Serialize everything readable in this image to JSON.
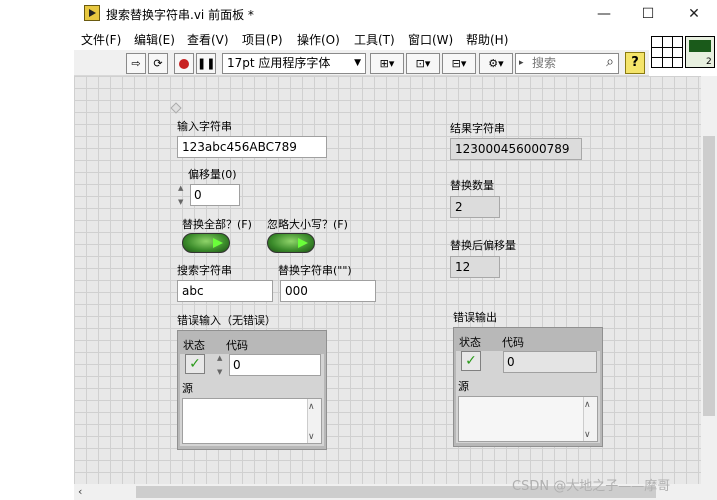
{
  "window": {
    "title": "搜索替换字符串.vi 前面板 *",
    "minimize": "—",
    "maximize": "☐",
    "close": "✕"
  },
  "menu": [
    "文件(F)",
    "编辑(E)",
    "查看(V)",
    "项目(P)",
    "操作(O)",
    "工具(T)",
    "窗口(W)",
    "帮助(H)"
  ],
  "toolbar": {
    "font": "17pt 应用程序字体",
    "search_placeholder": "搜索",
    "help": "?",
    "connector_count": "2"
  },
  "controls": {
    "input_string": {
      "label": "输入字符串",
      "value": "123abc456ABC789"
    },
    "offset": {
      "label": "偏移量(0)",
      "value": "0"
    },
    "replace_all": {
      "label": "替换全部？(F)"
    },
    "ignore_case": {
      "label": "忽略大小写？(F)"
    },
    "search_string": {
      "label": "搜索字符串",
      "value": "abc"
    },
    "replace_string": {
      "label": "替换字符串(\"\")",
      "value": "000"
    },
    "error_in": {
      "label": "错误输入（无错误）",
      "status_label": "状态",
      "code_label": "代码",
      "code_value": "0",
      "source_label": "源"
    }
  },
  "indicators": {
    "result_string": {
      "label": "结果字符串",
      "value": "123000456000789"
    },
    "replace_count": {
      "label": "替换数量",
      "value": "2"
    },
    "offset_past": {
      "label": "替换后偏移量",
      "value": "12"
    },
    "error_out": {
      "label": "错误输出",
      "status_label": "状态",
      "code_label": "代码",
      "code_value": "0",
      "source_label": "源"
    }
  },
  "watermark": "CSDN @大地之子——摩哥"
}
